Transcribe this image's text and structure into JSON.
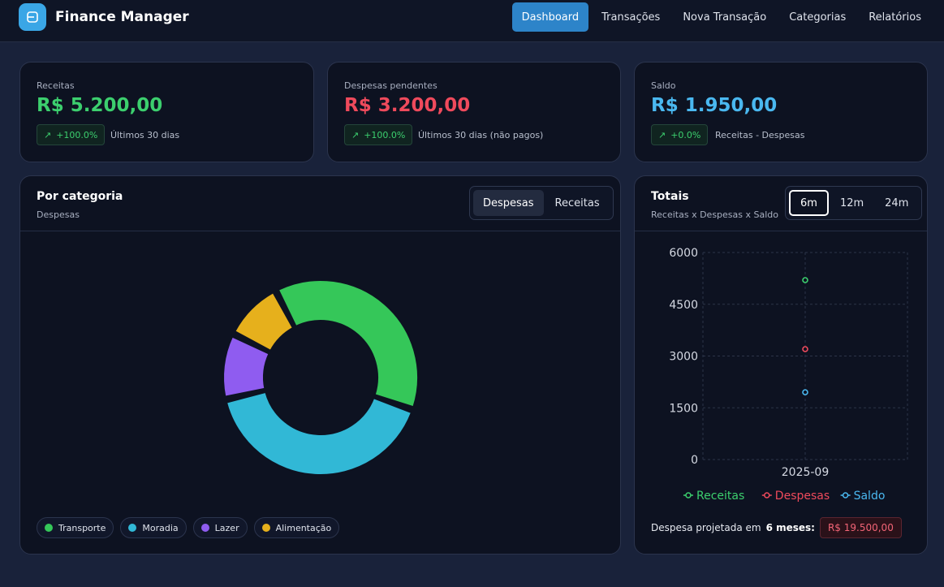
{
  "app": {
    "title": "Finance Manager",
    "logo_icon": "wallet-icon"
  },
  "nav": {
    "items": [
      {
        "label": "Dashboard",
        "active": true
      },
      {
        "label": "Transações",
        "active": false
      },
      {
        "label": "Nova Transação",
        "active": false
      },
      {
        "label": "Categorias",
        "active": false
      },
      {
        "label": "Relatórios",
        "active": false
      }
    ]
  },
  "stats": [
    {
      "label": "Receitas",
      "value": "R$ 5.200,00",
      "color": "#3ccf6e",
      "change": "+100.0%",
      "note": "Últimos 30 dias"
    },
    {
      "label": "Despesas pendentes",
      "value": "R$ 3.200,00",
      "color": "#ef4a5c",
      "change": "+100.0%",
      "note": "Últimos 30 dias (não pagos)"
    },
    {
      "label": "Saldo",
      "value": "R$ 1.950,00",
      "color": "#4ab8f0",
      "change": "+0.0%",
      "note": "Receitas - Despesas"
    }
  ],
  "category_card": {
    "title": "Por categoria",
    "subtitle": "Despesas",
    "toggle": [
      {
        "label": "Despesas",
        "active": true
      },
      {
        "label": "Receitas",
        "active": false
      }
    ],
    "legend": [
      {
        "label": "Transporte",
        "color": "#35c759"
      },
      {
        "label": "Moradia",
        "color": "#31b8d6"
      },
      {
        "label": "Lazer",
        "color": "#8f5cf0"
      },
      {
        "label": "Alimentação",
        "color": "#e6b01c"
      }
    ]
  },
  "totals_card": {
    "title": "Totais",
    "subtitle": "Receitas x Despesas x Saldo",
    "ranges": [
      {
        "label": "6m",
        "active": true
      },
      {
        "label": "12m",
        "active": false
      },
      {
        "label": "24m",
        "active": false
      }
    ],
    "projection_prefix": "Despesa projetada em",
    "projection_period": "6 meses:",
    "projection_value": "R$ 19.500,00"
  },
  "chart_data": [
    {
      "type": "pie",
      "variant": "donut",
      "labels": [
        "Transporte",
        "Moradia",
        "Lazer",
        "Alimentação"
      ],
      "values": [
        38,
        41,
        11,
        10
      ],
      "colors": [
        "#35c759",
        "#31b8d6",
        "#8f5cf0",
        "#e6b01c"
      ]
    },
    {
      "type": "scatter",
      "categories": [
        "2025-09"
      ],
      "series": [
        {
          "name": "Receitas",
          "values": [
            5200
          ],
          "color": "#3ccf6e"
        },
        {
          "name": "Despesas",
          "values": [
            3200
          ],
          "color": "#ef4a5c"
        },
        {
          "name": "Saldo",
          "values": [
            1950
          ],
          "color": "#4ab8f0"
        }
      ],
      "ylim": [
        0,
        6000
      ],
      "yticks": [
        "6000",
        "4500",
        "3000",
        "1500",
        "0"
      ],
      "grid": true,
      "legend_position": "bottom"
    }
  ]
}
